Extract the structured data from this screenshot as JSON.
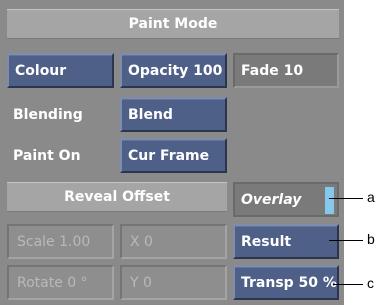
{
  "panel": {
    "paint_mode_title": "Paint Mode",
    "colour_label": "Colour",
    "opacity_label": "Opacity 100",
    "fade_label": "Fade 10",
    "blending_label": "Blending",
    "blend_label": "Blend",
    "paint_on_label": "Paint On",
    "cur_frame_label": "Cur Frame",
    "reveal_offset_title": "Reveal Offset",
    "overlay_label": "Overlay",
    "scale_label": "Scale 1.00",
    "x_label": "X 0",
    "result_label": "Result",
    "rotate_label": "Rotate 0 °",
    "y_label": "Y 0",
    "transp_label": "Transp 50 %"
  },
  "callouts": {
    "a": "a",
    "b": "b",
    "c": "c"
  },
  "colors": {
    "panel_bg": "#8a8a8a",
    "button_blue": "#4e5f88",
    "overlay_swatch": "#86c8ec"
  }
}
